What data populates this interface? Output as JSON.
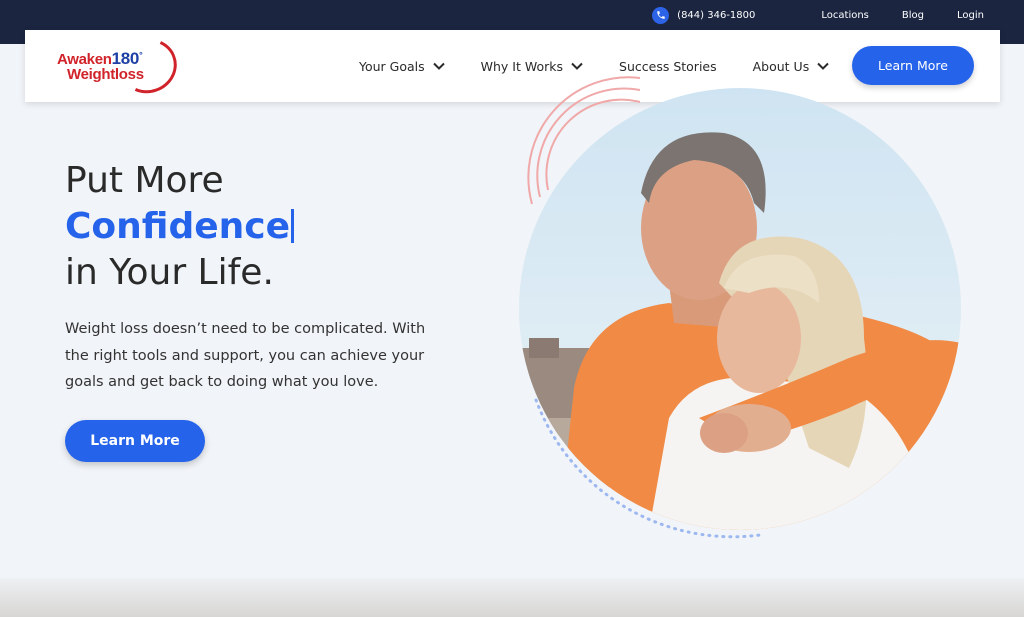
{
  "topbar": {
    "phone": "(844) 346-1800",
    "links": [
      "Locations",
      "Blog",
      "Login"
    ]
  },
  "logo": {
    "line1_word": "Awaken",
    "line1_number": "180",
    "line1_symbol": "°",
    "line2": "Weightloss"
  },
  "nav": {
    "items": [
      {
        "label": "Your Goals",
        "dropdown": true
      },
      {
        "label": "Why It Works",
        "dropdown": true
      },
      {
        "label": "Success Stories",
        "dropdown": false
      },
      {
        "label": "About Us",
        "dropdown": true
      }
    ],
    "cta": "Learn More"
  },
  "hero": {
    "line1": "Put More",
    "accent": "Confidence",
    "line3": "in Your Life.",
    "body": "Weight loss doesn’t need to be complicated. With the right tools and support, you can achieve your goals and get back to doing what you love.",
    "cta": "Learn More"
  },
  "colors": {
    "topbar": "#1b2540",
    "primary": "#2563eb",
    "brand_red": "#d1232a",
    "background": "#f1f4f8"
  },
  "icons": [
    "phone-icon",
    "chevron-down-icon"
  ]
}
